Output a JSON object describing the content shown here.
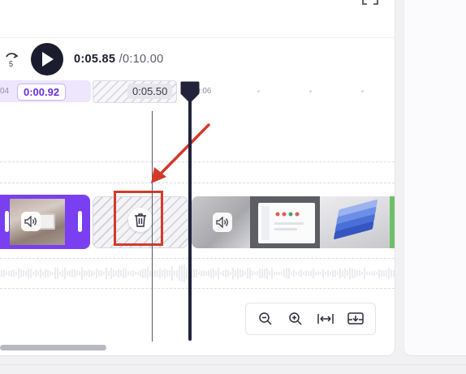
{
  "player": {
    "current_time": "0:05.85",
    "separator": "/",
    "total_time": "0:10.00",
    "skip_seconds": "5"
  },
  "ruler": {
    "left_tick": "04",
    "right_tick": "0:06"
  },
  "selected_clip": {
    "duration": "0:00.92"
  },
  "gap": {
    "duration": "0:05.50"
  },
  "annotation": {
    "arrow_color": "#d33a2c",
    "box_color": "#d33a2c"
  },
  "colors": {
    "accent": "#7a3ff0",
    "playhead": "#22233a"
  },
  "icons": {
    "fullscreen": "fullscreen-icon",
    "skip": "skip-forward-5-icon",
    "play": "play-icon",
    "speaker": "speaker-icon",
    "trash": "trash-icon",
    "zoom_out": "zoom-out-icon",
    "zoom_in": "zoom-in-icon",
    "fit": "fit-width-icon",
    "more": "timeline-settings-icon"
  }
}
